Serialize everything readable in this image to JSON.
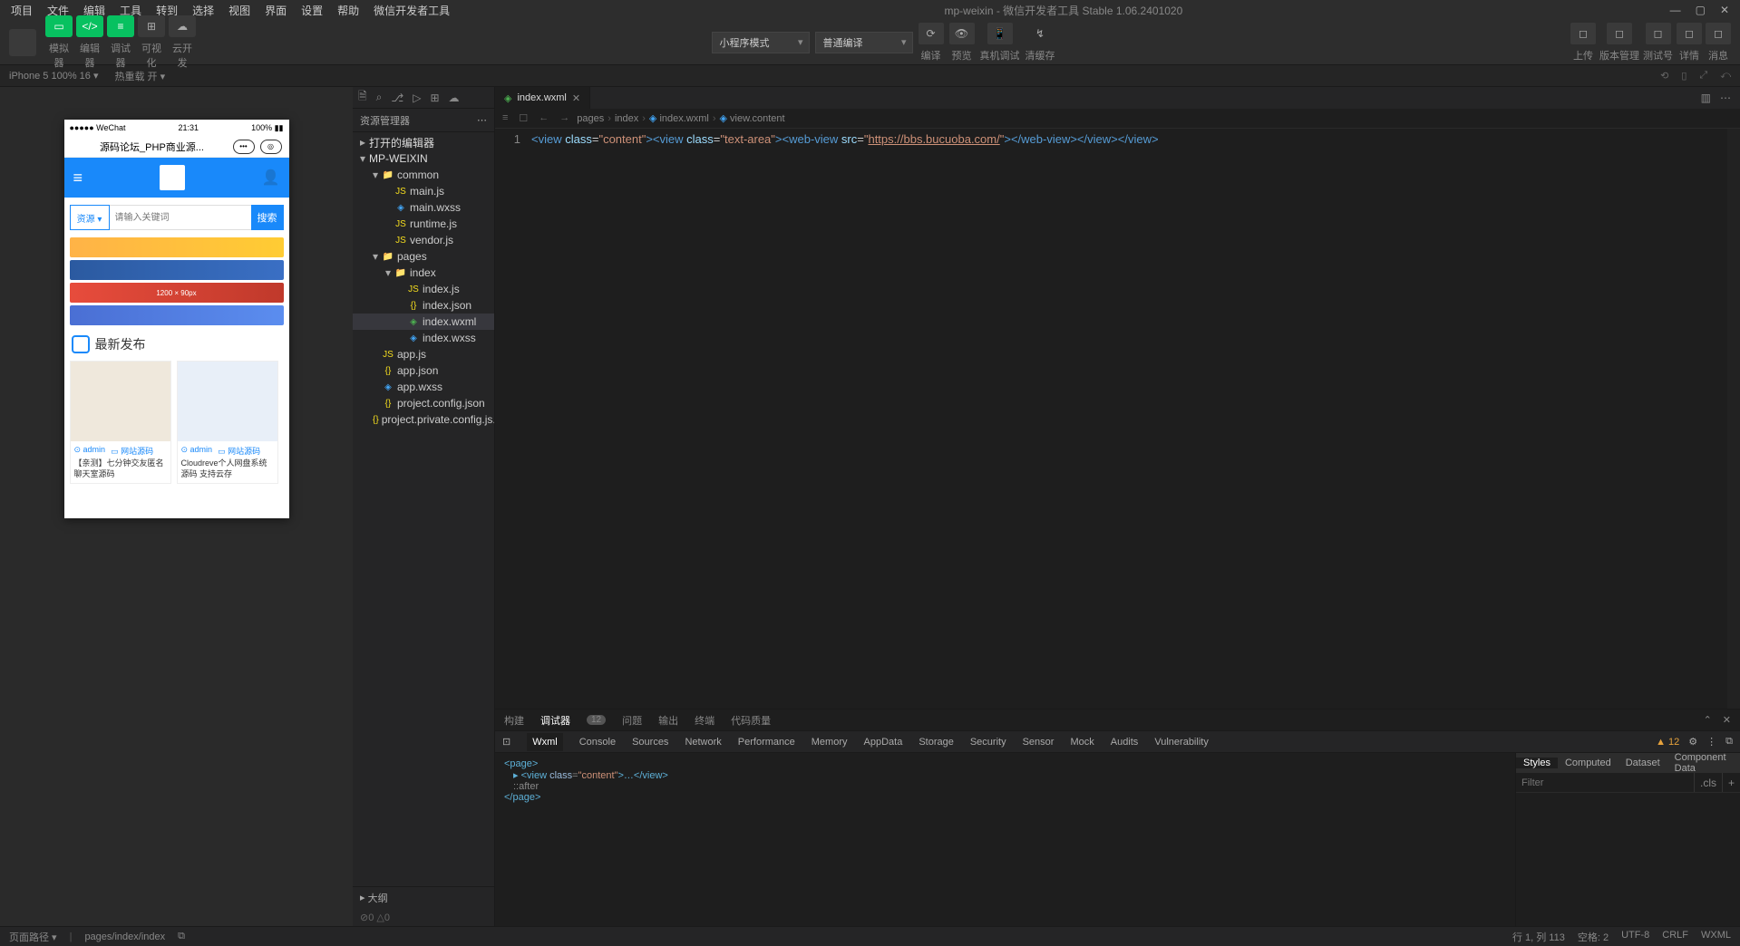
{
  "titlebar": {
    "menus": [
      "项目",
      "文件",
      "编辑",
      "工具",
      "转到",
      "选择",
      "视图",
      "界面",
      "设置",
      "帮助",
      "微信开发者工具"
    ],
    "title": "mp-weixin - 微信开发者工具 Stable 1.06.2401020"
  },
  "toolbar": {
    "groups": [
      "模拟器",
      "编辑器",
      "调试器",
      "可视化",
      "云开发"
    ],
    "compile_mode_label": "小程序模式",
    "compile_scheme_label": "普通编译",
    "actions": [
      "编译",
      "预览",
      "真机调试",
      "清缓存"
    ],
    "right": [
      "上传",
      "版本管理",
      "测试号",
      "详情",
      "消息"
    ]
  },
  "devicebar": {
    "device": "iPhone 5 100% 16 ▾",
    "reload": "热重载 开 ▾"
  },
  "phone": {
    "status_left": "●●●●● WeChat",
    "status_time": "21:31",
    "status_right": "100%",
    "nav_title": "源码论坛_PHP商业源...",
    "head_menu": "≡",
    "head_user": "◯",
    "search_sel": "资源 ▾",
    "search_ph": "请输入关键词",
    "search_btn": "搜索",
    "banner3": "1200 × 90px",
    "sec_title": "最新发布",
    "cards": [
      {
        "user": "admin",
        "cat": "网站源码",
        "title": "【亲测】七分钟交友匿名聊天室源码"
      },
      {
        "user": "admin",
        "cat": "网站源码",
        "title": "Cloudreve个人网盘系统源码 支持云存"
      }
    ]
  },
  "explorer": {
    "header": "资源管理器",
    "sections": {
      "opened": "打开的编辑器",
      "project": "MP-WEIXIN"
    },
    "tree": [
      {
        "d": 1,
        "chev": "▾",
        "icon": "📁",
        "cls": "fi-fold",
        "label": "common"
      },
      {
        "d": 2,
        "icon": "JS",
        "cls": "fi-js",
        "label": "main.js"
      },
      {
        "d": 2,
        "icon": "◈",
        "cls": "fi-wxss",
        "label": "main.wxss"
      },
      {
        "d": 2,
        "icon": "JS",
        "cls": "fi-js",
        "label": "runtime.js"
      },
      {
        "d": 2,
        "icon": "JS",
        "cls": "fi-js",
        "label": "vendor.js"
      },
      {
        "d": 1,
        "chev": "▾",
        "icon": "📁",
        "cls": "fi-fold",
        "label": "pages"
      },
      {
        "d": 2,
        "chev": "▾",
        "icon": "📁",
        "cls": "fi-fold",
        "label": "index"
      },
      {
        "d": 3,
        "icon": "JS",
        "cls": "fi-js",
        "label": "index.js"
      },
      {
        "d": 3,
        "icon": "{}",
        "cls": "fi-json",
        "label": "index.json"
      },
      {
        "d": 3,
        "icon": "◈",
        "cls": "fi-wxml",
        "label": "index.wxml",
        "active": true
      },
      {
        "d": 3,
        "icon": "◈",
        "cls": "fi-wxss",
        "label": "index.wxss"
      },
      {
        "d": 1,
        "icon": "JS",
        "cls": "fi-js",
        "label": "app.js"
      },
      {
        "d": 1,
        "icon": "{}",
        "cls": "fi-json",
        "label": "app.json"
      },
      {
        "d": 1,
        "icon": "◈",
        "cls": "fi-wxss",
        "label": "app.wxss"
      },
      {
        "d": 1,
        "icon": "{}",
        "cls": "fi-json",
        "label": "project.config.json"
      },
      {
        "d": 1,
        "icon": "{}",
        "cls": "fi-json",
        "label": "project.private.config.js..."
      }
    ],
    "outline": "大纲",
    "outline_stat": "⊘0 △0"
  },
  "editor": {
    "tab": "index.wxml",
    "breadcrumb": [
      "pages",
      "index",
      "index.wxml",
      "view.content"
    ],
    "line_no": "1",
    "code": {
      "p1": "<",
      "p2": "view",
      "p3": " ",
      "p4": "class",
      "p5": "=",
      "p6": "\"content\"",
      "p7": "><",
      "p8": "view",
      "p9": " ",
      "p10": "class",
      "p11": "=",
      "p12": "\"text-area\"",
      "p13": "><",
      "p14": "web-view",
      "p15": " ",
      "p16": "src",
      "p17": "=",
      "p18": "\"",
      "p19": "https://bbs.bucuoba.com/",
      "p20": "\"",
      "p21": "></",
      "p22": "web-view",
      "p23": "></",
      "p24": "view",
      "p25": "></",
      "p26": "view",
      "p27": ">"
    }
  },
  "debug": {
    "tabs": [
      "构建",
      "调试器",
      "问题",
      "输出",
      "终端",
      "代码质量"
    ],
    "badge": "12",
    "devtabs": [
      "Wxml",
      "Console",
      "Sources",
      "Network",
      "Performance",
      "Memory",
      "AppData",
      "Storage",
      "Security",
      "Sensor",
      "Mock",
      "Audits",
      "Vulnerability"
    ],
    "warn_count": "▲ 12",
    "dom": {
      "l1": "<page>",
      "l2a": "▸ <view ",
      "l2b": "class",
      "l2c": "=",
      "l2d": "\"content\"",
      "l2e": ">…</view>",
      "l3": "::after",
      "l4": "</page>"
    },
    "style_tabs": [
      "Styles",
      "Computed",
      "Dataset",
      "Component Data"
    ],
    "filter_ph": "Filter",
    "cls": ".cls"
  },
  "statusbar": {
    "left1": "页面路径 ▾",
    "left2": "pages/index/index",
    "right": [
      "行 1, 列 113",
      "空格: 2",
      "UTF-8",
      "CRLF",
      "WXML"
    ]
  }
}
